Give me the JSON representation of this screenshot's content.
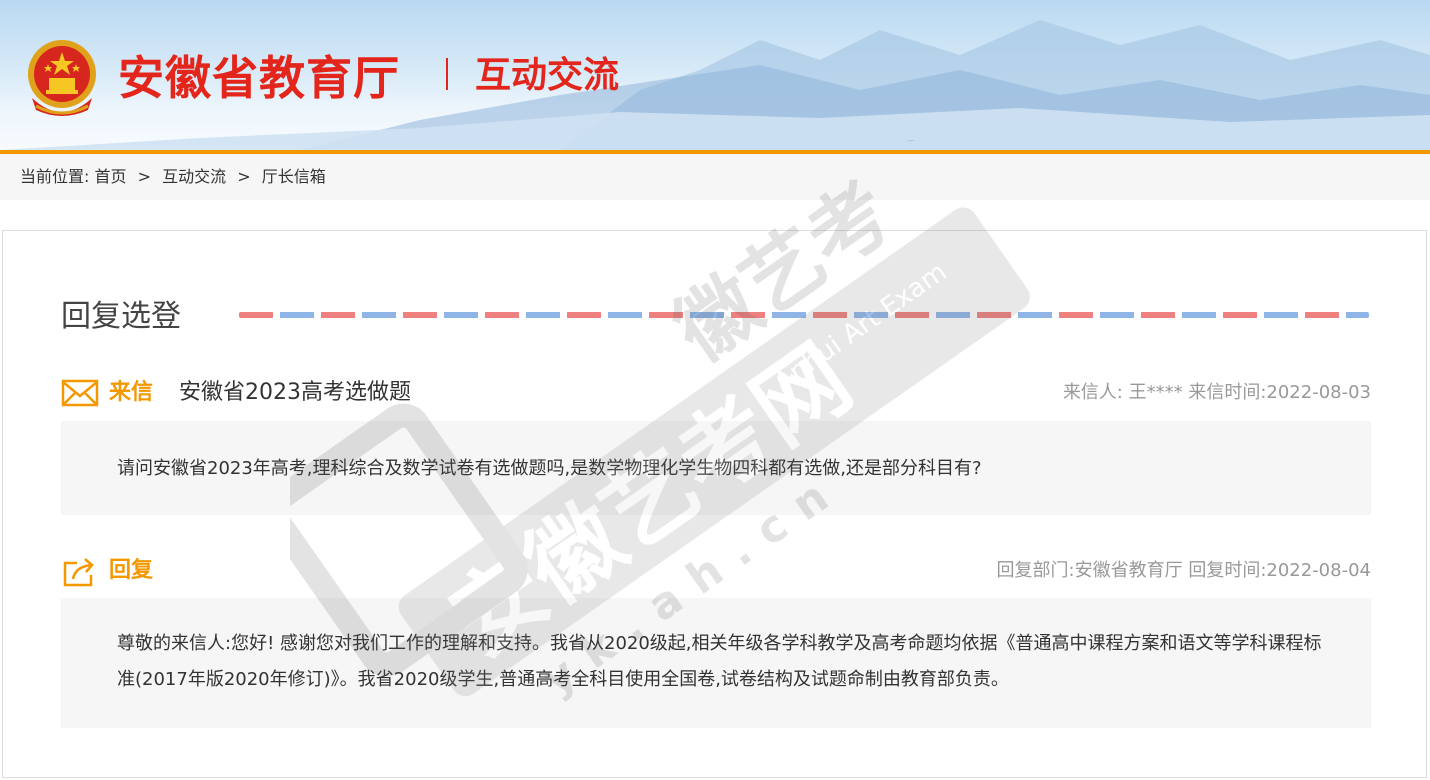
{
  "header": {
    "site_title": "安徽省教育厅",
    "section_title": "互动交流",
    "accent_color": "#e3251b",
    "rule_color": "#f39800"
  },
  "breadcrumb": {
    "label": "当前位置:",
    "items": [
      "首页",
      "互动交流",
      "厅长信箱"
    ],
    "separator": ">"
  },
  "panel": {
    "title": "回复选登",
    "letter": {
      "icon": "envelope-icon",
      "tag": "来信",
      "subject": "安徽省2023高考选做题",
      "meta": "来信人: 王**** 来信时间:2022-08-03",
      "body": "请问安徽省2023年高考,理科综合及数学试卷有选做题吗,是数学物理化学生物四科都有选做,还是部分科目有?"
    },
    "reply": {
      "icon": "share-reply-icon",
      "tag": "回复",
      "meta": "回复部门:安徽省教育厅 回复时间:2022-08-04",
      "body": "尊敬的来信人:您好! 感谢您对我们工作的理解和支持。我省从2020级起,相关年级各学科教学及高考命题均依据《普通高中课程方案和语文等学科课程标准(2017年版2020年修订)》。我省2020级学生,普通高考全科目使用全国卷,试卷结构及试题命制由教育部负责。"
    }
  },
  "watermark": {
    "text_cn": "安徽艺考网",
    "text_brand": "徽艺考",
    "text_en": "Anhui Art Exam",
    "url": "yk.ah.cn",
    "mark": "®"
  }
}
